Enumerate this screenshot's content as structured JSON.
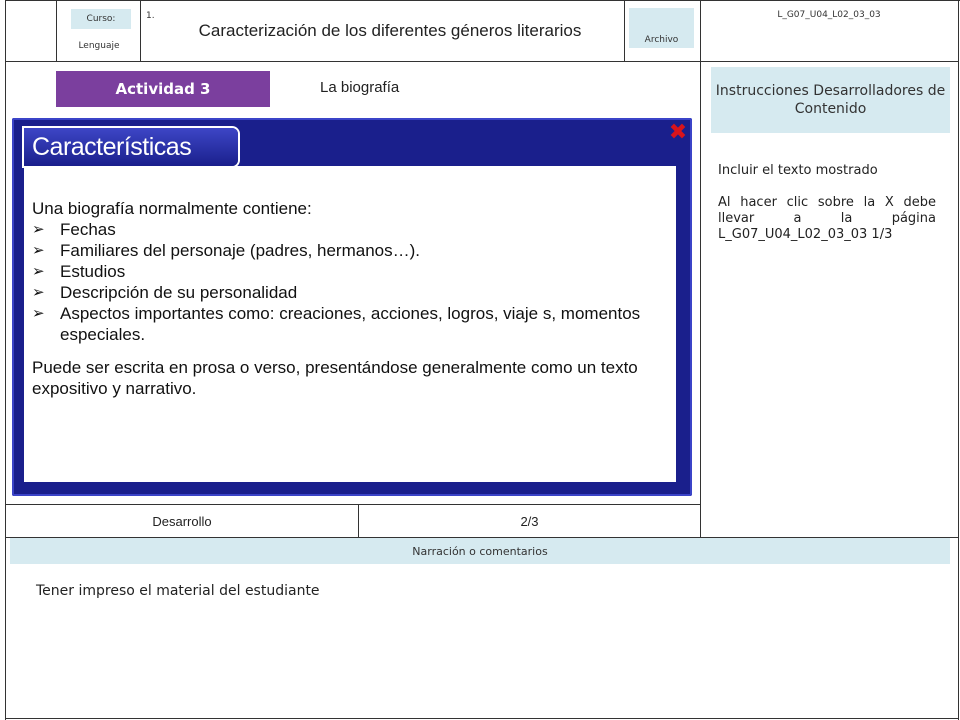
{
  "header": {
    "curso_label": "Curso:",
    "curso_value": "Lenguaje",
    "grade": "1.",
    "title": "Caracterización de los diferentes géneros literarios",
    "archivo_label": "Archivo",
    "code": "L_G07_U04_L02_03_03"
  },
  "activity": {
    "label": "Actividad 3",
    "topic": "La biografía"
  },
  "panel": {
    "tab_title": "Características",
    "intro": "Una biografía normalmente contiene:",
    "bullets": [
      "Fechas",
      "Familiares del personaje (padres, hermanos…).",
      "Estudios",
      "Descripción de su personalidad",
      "Aspectos importantes como: creaciones, acciones, logros, viaje s, momentos especiales."
    ],
    "closing": "Puede ser escrita en prosa o verso, presentándose generalmente como un texto expositivo y narrativo.",
    "close_glyph": "✖"
  },
  "instructions": {
    "header": "Instrucciones Desarrolladores de Contenido",
    "line1": "Incluir el texto mostrado",
    "line2": "Al hacer clic sobre la X debe llevar a la página L_G07_U04_L02_03_03 1/3"
  },
  "footer": {
    "section": "Desarrollo",
    "page": "2/3"
  },
  "narration": {
    "header": "Narración o comentarios",
    "text": "Tener impreso el material del estudiante"
  },
  "bullet_glyph": "➢"
}
